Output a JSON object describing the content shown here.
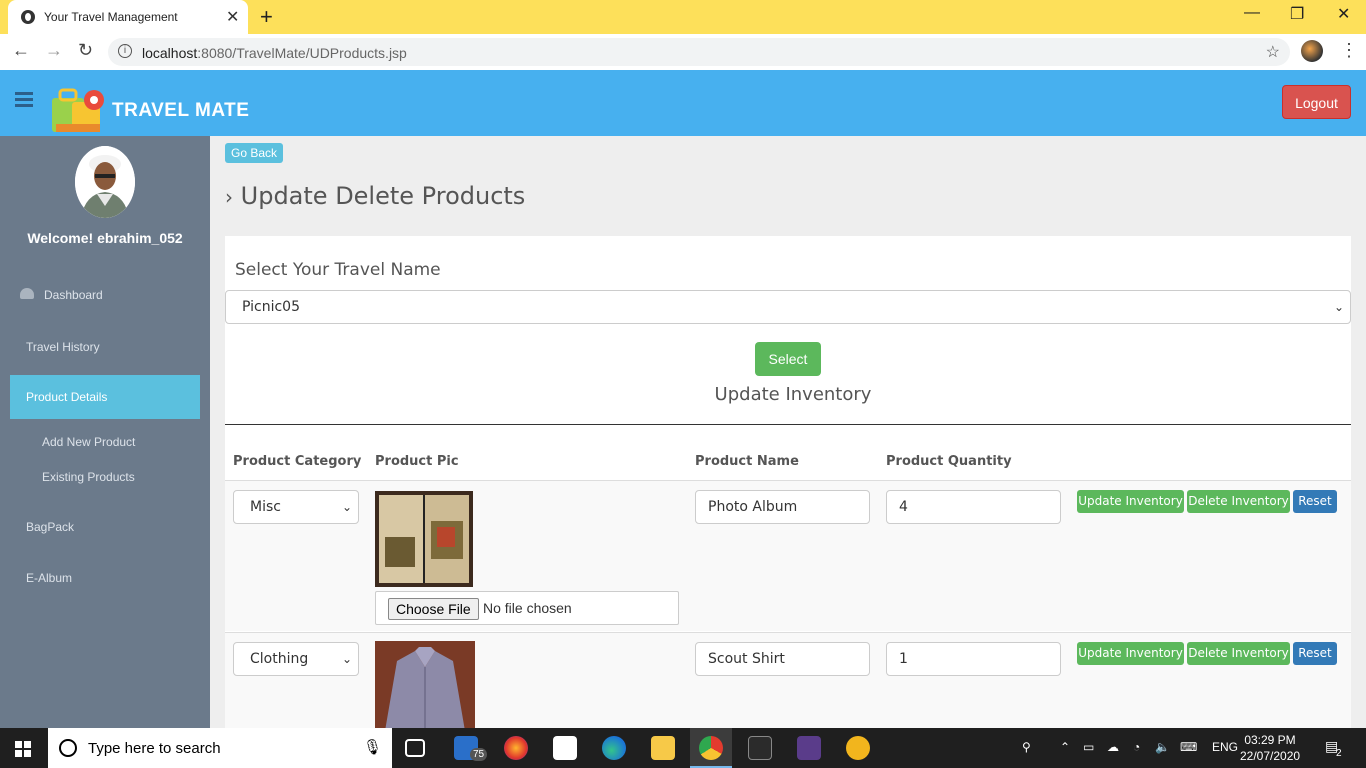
{
  "browser": {
    "tab_title": "Your Travel Management",
    "url_host": "localhost",
    "url_path": ":8080/TravelMate/UDProducts.jsp"
  },
  "header": {
    "brand": "TRAVEL MATE",
    "logout_label": "Logout"
  },
  "sidebar": {
    "welcome": "Welcome! ebrahim_052",
    "items": [
      {
        "label": "Dashboard"
      },
      {
        "label": "Travel History"
      },
      {
        "label": "Product Details"
      },
      {
        "label": "Add New Product"
      },
      {
        "label": "Existing Products"
      },
      {
        "label": "BagPack"
      },
      {
        "label": "E-Album"
      }
    ]
  },
  "main": {
    "go_back_label": "Go Back",
    "page_title": "Update Delete Products",
    "select_label": "Select Your Travel Name",
    "travel_selected": "Picnic05",
    "select_button": "Select",
    "update_title": "Update Inventory",
    "columns": [
      "Product Category",
      "Product Pic",
      "Product Name",
      "Product Quantity"
    ],
    "rows": [
      {
        "category": "Misc",
        "name": "Photo Album",
        "quantity": "4",
        "pic": "photo-album-image"
      },
      {
        "category": "Clothing",
        "name": "Scout Shirt",
        "quantity": "1",
        "pic": "shirt-image"
      }
    ],
    "file_button": "Choose File",
    "file_status": "No file chosen",
    "update_btn": "Update Inventory",
    "delete_btn": "Delete Inventory",
    "reset_btn": "Reset"
  },
  "taskbar": {
    "search_placeholder": "Type here to search",
    "mail_badge": "75",
    "language": "ENG",
    "time": "03:29 PM",
    "date": "22/07/2020",
    "notification_count": "2"
  }
}
